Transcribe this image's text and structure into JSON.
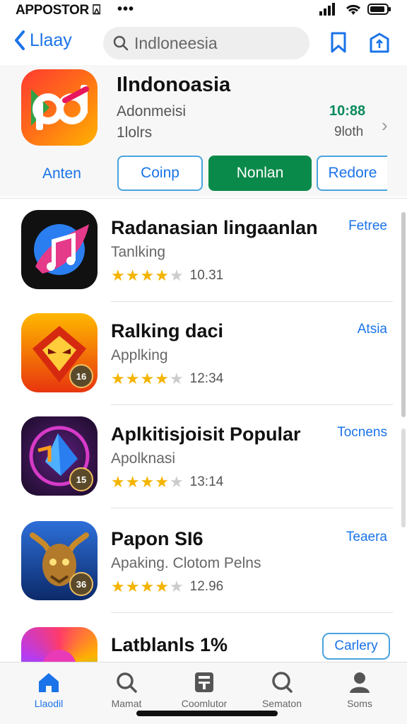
{
  "status_bar": {
    "carrier": "APPOSTOR ⍓",
    "dots": "•••"
  },
  "header": {
    "back_label": "Llaay",
    "search_placeholder": "Indloneesia"
  },
  "featured": {
    "title": "Ilndonoasia",
    "subtitle": "Adonmeisi",
    "subtitle2": "1lolrs",
    "time": "10:88",
    "size": "9loth",
    "left_label": "Anten",
    "buttons": [
      "Coinp",
      "Nonlan",
      "Redore"
    ]
  },
  "apps": [
    {
      "name": "Radanasian lingaanlan",
      "category": "Tanlking",
      "rating_value": "10.31",
      "stars": 4.5,
      "action": "Fetree"
    },
    {
      "name": "Ralking daci",
      "category": "Applking",
      "rating_value": "12:34",
      "stars": 4.5,
      "action": "Atsia",
      "badge": "16"
    },
    {
      "name": "Aplkitisjoisit Popular",
      "category": "Apolknasi",
      "rating_value": "13:14",
      "stars": 4.5,
      "action": "Tocnens",
      "badge": "15"
    },
    {
      "name": "Papon SI6",
      "category": "Apaking. Clotom Pelns",
      "rating_value": "12.96",
      "stars": 4.5,
      "action": "Teaera",
      "badge": "36"
    },
    {
      "name": "Latblanls 1%",
      "category": "",
      "rating_value": "",
      "stars": 0,
      "action": "Carlery"
    }
  ],
  "tabs": [
    {
      "label": "Llaodil",
      "icon": "home-icon",
      "active": true
    },
    {
      "label": "Mamat",
      "icon": "search-icon"
    },
    {
      "label": "Coomlutor",
      "icon": "calculator-icon"
    },
    {
      "label": "Sematon",
      "icon": "search-icon"
    },
    {
      "label": "Soms",
      "icon": "person-icon"
    }
  ],
  "colors": {
    "accent": "#1a73e8",
    "install_green": "#0a8a4a",
    "star": "#f4b400"
  }
}
